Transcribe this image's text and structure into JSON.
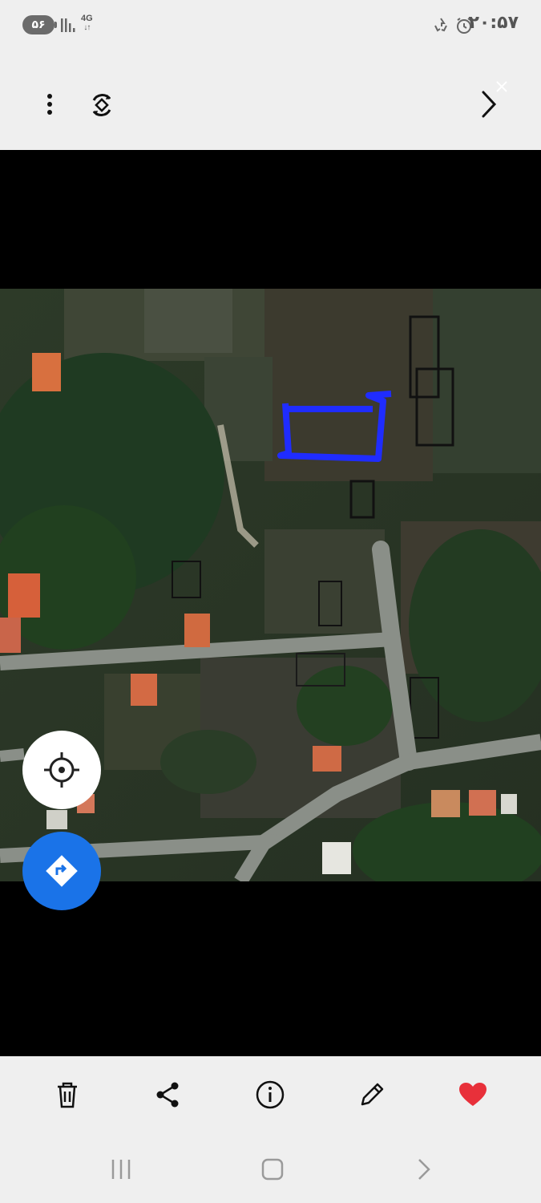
{
  "status_bar": {
    "time": "۲۰:۵۷",
    "battery_level": "۵۶",
    "network_type": "4G",
    "network_arrows": "↓↑",
    "icons": [
      "signal-icon",
      "recycle-icon",
      "alarm-icon"
    ]
  },
  "top_toolbar": {
    "icons": [
      "more-vertical-icon",
      "rotate-icon",
      "chevron-right-icon",
      "close-icon"
    ]
  },
  "map_controls": {
    "icons": [
      "my-location-icon",
      "directions-icon"
    ],
    "accent": "#1a73e8"
  },
  "bottom_toolbar": {
    "icons": [
      "delete-icon",
      "share-icon",
      "info-icon",
      "edit-icon",
      "favorite-heart-icon"
    ],
    "favorite_color": "#e8303a"
  },
  "nav_bar": {
    "icons": [
      "recent-apps-icon",
      "home-icon",
      "back-icon"
    ]
  },
  "annotation": {
    "color": "#1f2cff"
  }
}
